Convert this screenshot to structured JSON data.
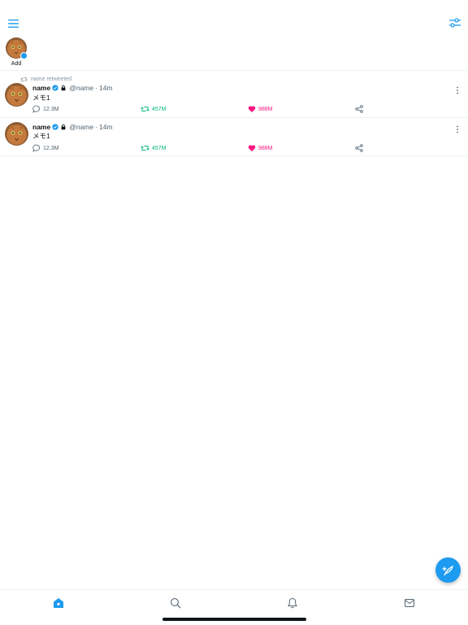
{
  "colors": {
    "accent": "#1d9bf0",
    "retweet": "#00ba7c",
    "like": "#f91880",
    "muted": "#536471"
  },
  "header": {
    "menu_icon": "hamburger-icon",
    "filter_icon": "sliders-icon"
  },
  "fleets": {
    "add_label": "Add"
  },
  "timeline": {
    "tweets": [
      {
        "retweet_banner": "name retweeted",
        "name": "name",
        "handle": "@name",
        "separator": "·",
        "time": "14m",
        "text": "メモ1",
        "reply_count": "12.3M",
        "retweet_count": "457M",
        "like_count": "988M"
      },
      {
        "name": "name",
        "handle": "@name",
        "separator": "·",
        "time": "14m",
        "text": "メモ1",
        "reply_count": "12.3M",
        "retweet_count": "457M",
        "like_count": "988M"
      }
    ]
  },
  "tabbar": {
    "tabs": [
      "home-icon",
      "search-icon",
      "notifications-icon",
      "messages-icon"
    ]
  },
  "fab": {
    "icon": "compose-icon"
  }
}
